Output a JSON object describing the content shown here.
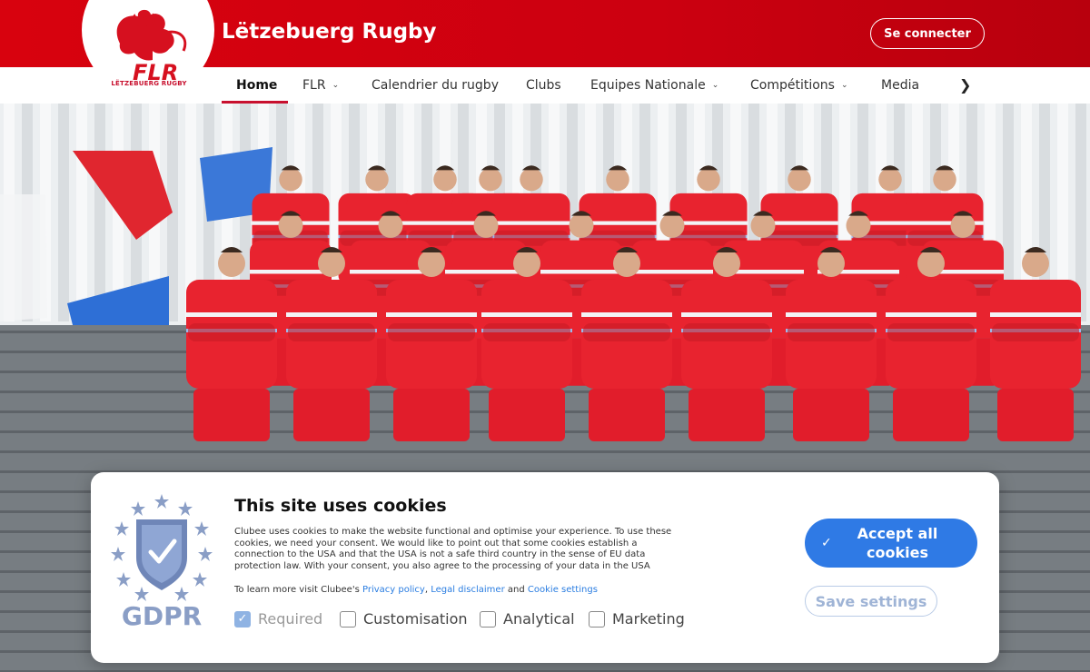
{
  "header": {
    "site_title": "Lëtzebuerg Rugby",
    "login_label": "Se connecter",
    "logo_text": "FLR",
    "logo_subtext": "LËTZEBUERG RUGBY"
  },
  "nav": {
    "items": [
      {
        "label": "Home",
        "has_dropdown": false,
        "active": true
      },
      {
        "label": "FLR",
        "has_dropdown": true
      },
      {
        "label": "Calendrier du rugby",
        "has_dropdown": false
      },
      {
        "label": "Clubs",
        "has_dropdown": false
      },
      {
        "label": "Equipes Nationale",
        "has_dropdown": true
      },
      {
        "label": "Compétitions",
        "has_dropdown": true
      },
      {
        "label": "Media",
        "has_dropdown": false
      }
    ],
    "next_icon": "chevron-right-icon"
  },
  "cookie_banner": {
    "title": "This site uses cookies",
    "body": "Clubee uses cookies to make the website functional and optimise your experience. To use these cookies, we need your consent. We would like to point out that some cookies establish a connection to the USA and that the USA is not a safe third country in the sense of EU data protection law. With your consent, you also agree to the processing of your data in the USA",
    "learn_prefix": "To learn more visit Clubee's",
    "privacy_link": "Privacy policy",
    "legal_link": "Legal disclaimer",
    "and_word": "and",
    "cookie_settings_link": "Cookie settings",
    "badge_text": "GDPR",
    "options": [
      {
        "label": "Required",
        "checked": true,
        "disabled": true
      },
      {
        "label": "Customisation",
        "checked": false
      },
      {
        "label": "Analytical",
        "checked": false
      },
      {
        "label": "Marketing",
        "checked": false
      }
    ],
    "accept_label": "Accept all cookies",
    "save_label": "Save settings"
  },
  "colors": {
    "brand_red": "#d8020e",
    "accent_blue": "#2f7ae5",
    "jersey_red": "#e8232f"
  }
}
